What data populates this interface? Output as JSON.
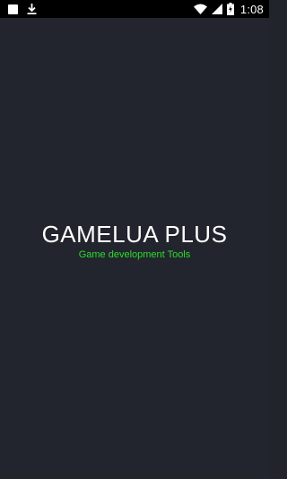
{
  "status_bar": {
    "time": "1:08",
    "icons": [
      "notification-square-icon",
      "download-icon",
      "wifi-icon",
      "signal-icon",
      "battery-charging-icon"
    ]
  },
  "splash": {
    "title": "GAMELUA PLUS",
    "subtitle": "Game development Tools"
  },
  "colors": {
    "background": "#22252d",
    "status_bar": "#000000",
    "title": "#ffffff",
    "subtitle": "#2cdc2c"
  }
}
